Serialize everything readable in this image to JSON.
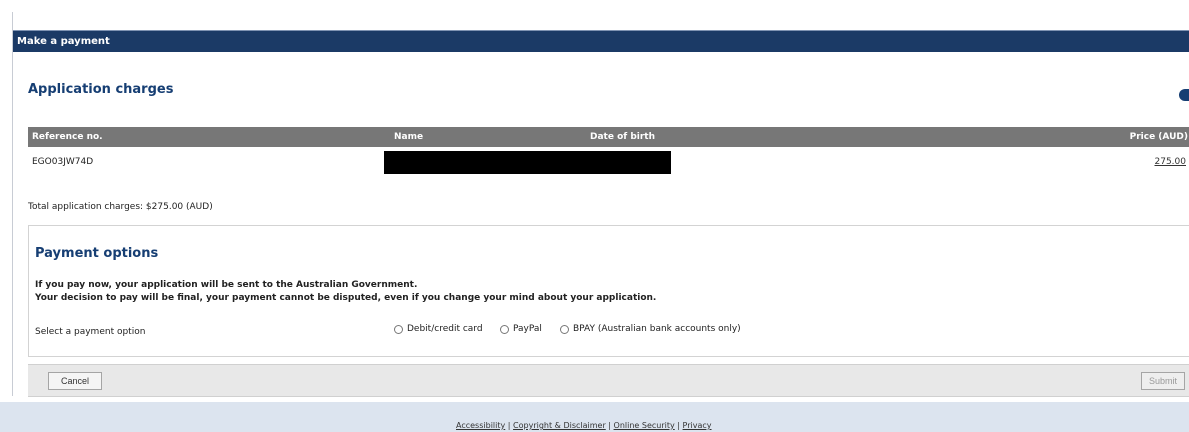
{
  "window": {
    "title": "Make a payment"
  },
  "application": {
    "section_title": "Application charges",
    "help_icon": "help-icon",
    "table": {
      "headers": [
        "Reference no.",
        "Name",
        "Date of birth",
        "Price (AUD)"
      ],
      "rows": [
        {
          "reference": "EGO03JW74D",
          "price": "275.00"
        }
      ]
    },
    "total_charges": "Total application charges: $275.00 (AUD)"
  },
  "payment": {
    "section_title": "Payment options",
    "notice_line_1": "If you pay now, your application will be sent to the Australian Government.",
    "notice_line_2": "Your decision to pay will be final, your payment cannot be disputed, even if you change your mind about your application.",
    "select_label": "Select a payment option",
    "options": [
      {
        "label": "Debit/credit card",
        "selected": false
      },
      {
        "label": "PayPal",
        "selected": false
      },
      {
        "label": "BPAY (Australian bank accounts only)",
        "selected": false
      }
    ]
  },
  "actions": {
    "cancel_label": "Cancel",
    "submit_label": "Submit",
    "submit_enabled": false
  },
  "footer": {
    "links": [
      "Accessibility",
      "Copyright & Disclaimer",
      "Online Security",
      "Privacy"
    ],
    "separator": "|"
  },
  "colors": {
    "title_bar": "#1b3a66",
    "section_title": "#163e73",
    "table_header": "#777777",
    "footer_background": "#dce4ef"
  }
}
